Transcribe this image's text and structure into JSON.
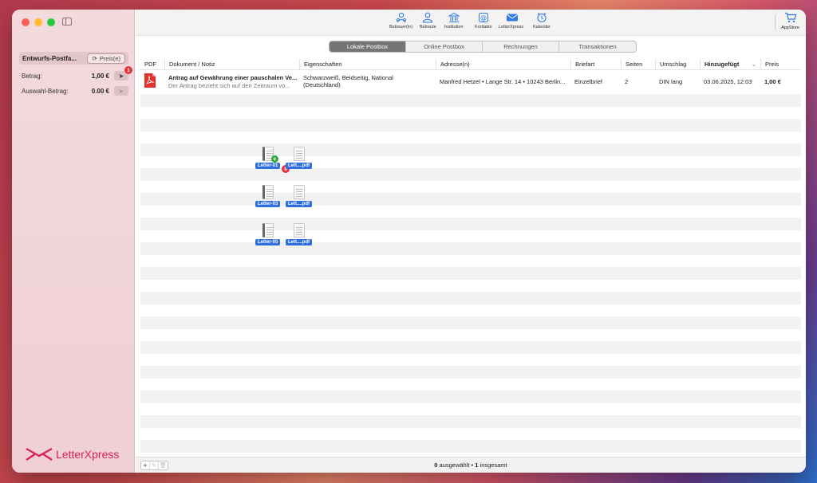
{
  "sidebar": {
    "draft_box_label": "Entwurfs-Postfa...",
    "price_button_label": "Preis(e)",
    "amount_label": "Betrag:",
    "amount_value": "1,00 €",
    "send_badge": "1",
    "selection_amount_label": "Auswahl-Betrag:",
    "selection_amount_value": "0.00 €",
    "logo_text": "LetterXpress"
  },
  "toolbar": {
    "items": [
      {
        "label": "Betreuer(in)",
        "icon": "person-group-icon"
      },
      {
        "label": "Betreute",
        "icon": "person-icon"
      },
      {
        "label": "Institution",
        "icon": "building-icon"
      },
      {
        "label": "Kontakte",
        "icon": "at-icon"
      },
      {
        "label": "LetterXpress",
        "icon": "envelope-icon"
      },
      {
        "label": "Kalender",
        "icon": "alarm-clock-icon"
      }
    ],
    "appstore_label": "AppStore"
  },
  "tabs": [
    {
      "label": "Lokale Postbox",
      "active": true
    },
    {
      "label": "Online Postbox",
      "active": false
    },
    {
      "label": "Rechnungen",
      "active": false
    },
    {
      "label": "Transaktionen",
      "active": false
    }
  ],
  "table": {
    "columns": [
      "PDF",
      "Dokument / Notiz",
      "Eigenschaften",
      "Adresse(n)",
      "Briefart",
      "Seiten",
      "Umschlag",
      "Hinzugefügt",
      "Preis"
    ],
    "rows": [
      {
        "title": "Antrag auf Gewährung einer pauschalen Ve...",
        "note": "Der Antrag bezieht sich auf den Zeitraum vo...",
        "properties_line1": "Schwarzweiß, Beidseitig, National",
        "properties_line2": "(Deutschland)",
        "address": "Manfred Hetzel • Lange Str. 14 • 10243 Berlin...",
        "letter_type": "Einzelbrief",
        "pages": "2",
        "envelope": "DIN lang",
        "added": "03.06.2025, 12:03",
        "price": "1,00 €"
      }
    ]
  },
  "drag": {
    "files": [
      {
        "label": "Letter-01"
      },
      {
        "label": "Lett....pdf"
      },
      {
        "label": "Letter-03"
      },
      {
        "label": "Lett....pdf"
      },
      {
        "label": "Letter-05"
      },
      {
        "label": "Lett....pdf"
      }
    ],
    "count_badge": "6",
    "plus_badge": "+"
  },
  "status": {
    "selected_count": "0",
    "selected_text": " ausgewählt • ",
    "total_count": "1",
    "total_text": " insgesamt"
  },
  "colors": {
    "accent": "#2e7ce0",
    "brand": "#d6235a",
    "badge": "#e8323c"
  }
}
